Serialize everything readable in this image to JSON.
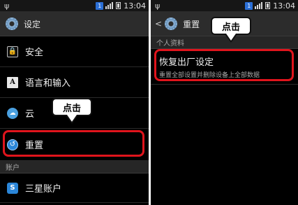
{
  "status_bar": {
    "time": "13:04",
    "badge": "1",
    "usb_symbol": "ψ"
  },
  "left_screen": {
    "title": "设定",
    "items": [
      {
        "label": "安全",
        "icon": "lock-icon",
        "glyph": "🔒"
      },
      {
        "label": "语言和输入",
        "icon": "language-icon",
        "glyph": "A"
      },
      {
        "label": "云",
        "icon": "cloud-icon",
        "glyph": "☁"
      },
      {
        "label": "重置",
        "icon": "reset-icon",
        "glyph": "↺"
      }
    ],
    "section_header": "账户",
    "account_item": {
      "label": "三星账户",
      "icon": "samsung-account-icon",
      "glyph": "S"
    },
    "callout": "点击"
  },
  "right_screen": {
    "back_symbol": "<",
    "title": "重置",
    "section_header": "个人资料",
    "factory_reset": {
      "title": "恢复出厂设定",
      "subtitle": "重置全部设置并删除设备上全部数据"
    },
    "callout": "点击"
  },
  "colors": {
    "highlight": "#e0141c",
    "accent": "#2b86d8",
    "background": "#000000"
  }
}
